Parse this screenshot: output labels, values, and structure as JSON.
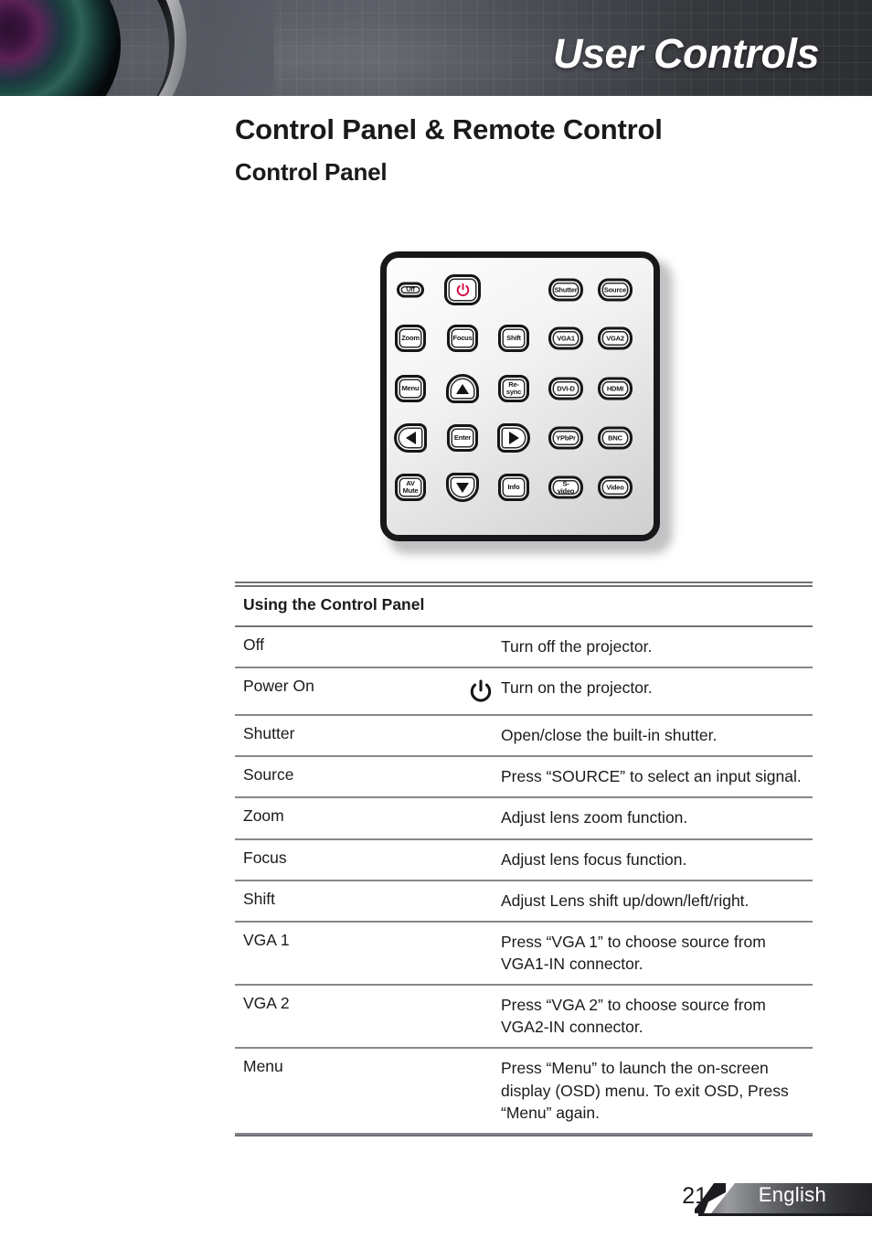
{
  "header": {
    "title": "User Controls",
    "lens_icon": "projector-lens-image"
  },
  "headings": {
    "h1": "Control Panel & Remote Control",
    "h2": "Control Panel"
  },
  "control_panel_figure": {
    "caption": "Control Panel",
    "buttons": [
      {
        "label": "Off",
        "style": "oval",
        "col": 0,
        "row": 0
      },
      {
        "label": "",
        "style": "power",
        "col": 1,
        "row": 0,
        "icon": "power-icon"
      },
      {
        "label": "Shutter",
        "style": "wide",
        "col": 3,
        "row": 0
      },
      {
        "label": "Source",
        "style": "wide",
        "col": 4,
        "row": 0
      },
      {
        "label": "Zoom",
        "style": "sq",
        "col": 0,
        "row": 1
      },
      {
        "label": "Focus",
        "style": "sq",
        "col": 1,
        "row": 1
      },
      {
        "label": "Shift",
        "style": "sq",
        "col": 2,
        "row": 1
      },
      {
        "label": "VGA1",
        "style": "wide",
        "col": 3,
        "row": 1
      },
      {
        "label": "VGA2",
        "style": "wide",
        "col": 4,
        "row": 1
      },
      {
        "label": "Menu",
        "style": "sq",
        "col": 0,
        "row": 2
      },
      {
        "label": "",
        "style": "arr-up",
        "col": 1,
        "row": 2,
        "icon": "arrow-up-icon"
      },
      {
        "label": "Re-sync",
        "style": "sq",
        "col": 2,
        "row": 2
      },
      {
        "label": "DVI-D",
        "style": "wide",
        "col": 3,
        "row": 2
      },
      {
        "label": "HDMI",
        "style": "wide",
        "col": 4,
        "row": 2
      },
      {
        "label": "",
        "style": "arr-left",
        "col": 0,
        "row": 3,
        "icon": "arrow-left-icon"
      },
      {
        "label": "Enter",
        "style": "sq",
        "col": 1,
        "row": 3
      },
      {
        "label": "",
        "style": "arr-right",
        "col": 2,
        "row": 3,
        "icon": "arrow-right-icon"
      },
      {
        "label": "YPbPr",
        "style": "wide",
        "col": 3,
        "row": 3
      },
      {
        "label": "BNC",
        "style": "wide",
        "col": 4,
        "row": 3
      },
      {
        "label": "AV Mute",
        "style": "sq",
        "col": 0,
        "row": 4
      },
      {
        "label": "",
        "style": "arr-down",
        "col": 1,
        "row": 4,
        "icon": "arrow-down-icon"
      },
      {
        "label": "Info",
        "style": "sq",
        "col": 2,
        "row": 4
      },
      {
        "label": "S-video",
        "style": "wide",
        "col": 3,
        "row": 4
      },
      {
        "label": "Video",
        "style": "wide",
        "col": 4,
        "row": 4
      }
    ],
    "power_icon_color": "#d6003c"
  },
  "table": {
    "title": "Using the Control Panel",
    "rows": [
      {
        "name": "Off",
        "icon": "",
        "desc": "Turn off the projector."
      },
      {
        "name": "Power On",
        "icon": "power-icon",
        "desc": "Turn on the projector."
      },
      {
        "name": "Shutter",
        "icon": "",
        "desc": "Open/close the built-in shutter."
      },
      {
        "name": "Source",
        "icon": "",
        "desc": "Press “SOURCE” to select an input signal."
      },
      {
        "name": "Zoom",
        "icon": "",
        "desc": "Adjust lens zoom function."
      },
      {
        "name": "Focus",
        "icon": "",
        "desc": "Adjust lens focus function."
      },
      {
        "name": "Shift",
        "icon": "",
        "desc": "Adjust Lens shift up/down/left/right."
      },
      {
        "name": "VGA 1",
        "icon": "",
        "desc": "Press “VGA 1” to choose source from VGA1-IN connector."
      },
      {
        "name": "VGA 2",
        "icon": "",
        "desc": "Press “VGA 2” to choose source from VGA2-IN connector."
      },
      {
        "name": "Menu",
        "icon": "",
        "desc": "Press “Menu” to launch the on-screen display (OSD) menu. To exit OSD, Press “Menu” again."
      }
    ]
  },
  "footer": {
    "page_number": "21",
    "language": "English"
  },
  "colors": {
    "header_bg_dark": "#2c2e32",
    "header_bg_light": "#5d6068",
    "rule": "#84878c",
    "text": "#1b1b1b",
    "power_red": "#d6003c",
    "footer_bar_light": "#9a9ca1",
    "footer_bar_dark": "#232427"
  }
}
